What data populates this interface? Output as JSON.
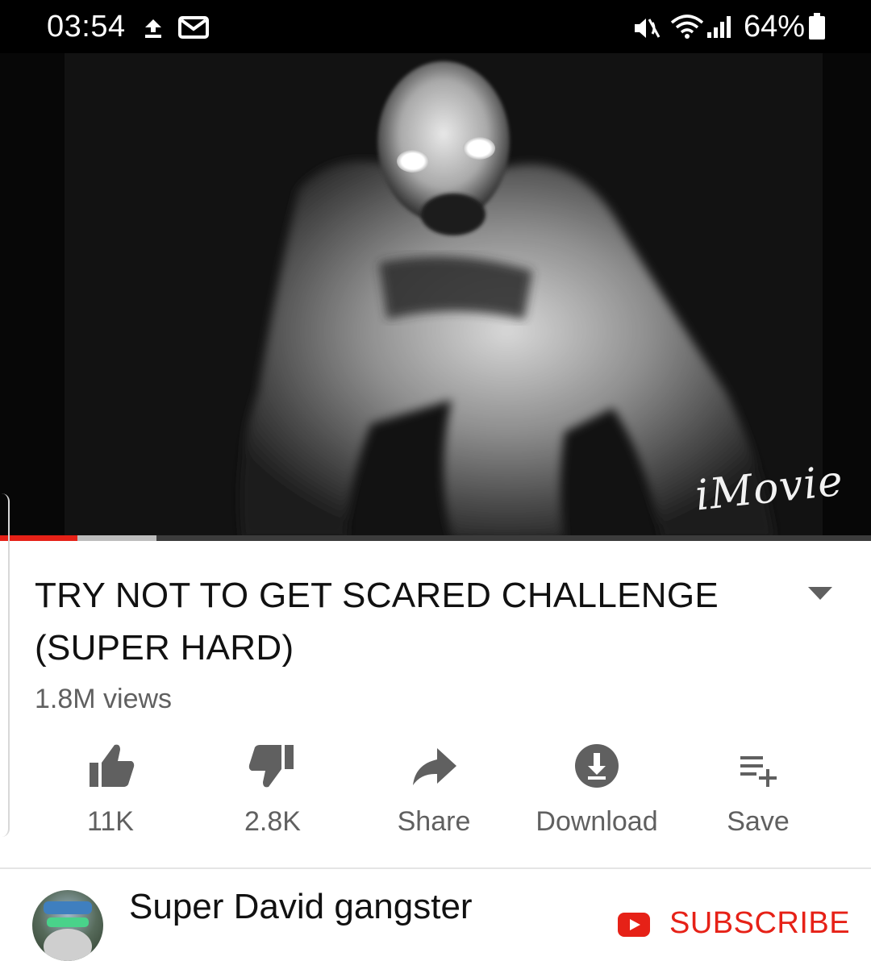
{
  "status_bar": {
    "time": "03:54",
    "battery_text": "64%",
    "icons": [
      "upload-icon",
      "mail-icon",
      "mute-icon",
      "wifi-icon",
      "signal-icon",
      "battery-icon"
    ]
  },
  "video": {
    "watermark": "iMovie",
    "progress_played": 0.089,
    "progress_buffered": 0.18
  },
  "title": {
    "line1": "TRY NOT TO GET SCARED CHALLENGE",
    "line2": "(SUPER HARD)"
  },
  "views": "1.8M views",
  "actions": {
    "like": "11K",
    "dislike": "2.8K",
    "share": "Share",
    "download": "Download",
    "save": "Save"
  },
  "channel": {
    "name": "Super David gangster",
    "subscribe_label": "SUBSCRIBE"
  },
  "colors": {
    "accent": "#e62117",
    "secondary_text": "#606060",
    "primary_text": "#111111"
  }
}
